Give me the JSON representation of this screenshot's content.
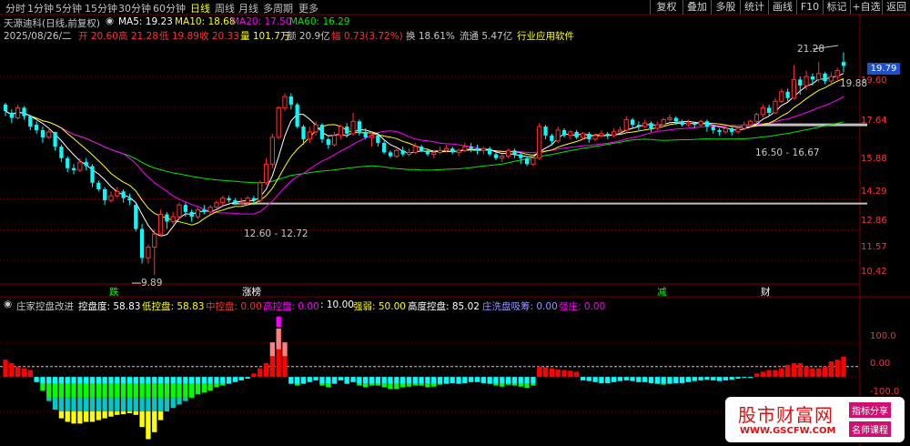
{
  "toolbar": {
    "timeframes": [
      "分时",
      "1分钟",
      "5分钟",
      "15分钟",
      "30分钟",
      "60分钟",
      "日线",
      "周线",
      "月线",
      "多周期",
      "更多"
    ],
    "active_index": 6,
    "buttons": [
      "复权",
      "叠加",
      "多股",
      "统计",
      "画线",
      "F10",
      "标记",
      "+自选",
      "返回"
    ]
  },
  "header": {
    "title": "天源迪科(日线,前复权)",
    "ma": [
      {
        "label": "MA5: 19.23",
        "color": "#ffffff"
      },
      {
        "label": "MA10: 18.68",
        "color": "#ffff00"
      },
      {
        "label": "MA20: 17.50",
        "color": "#ff00ff"
      },
      {
        "label": "MA60: 16.29",
        "color": "#00e600"
      }
    ],
    "quote": [
      {
        "text": "2025/08/26/二",
        "color": "#c8c8c8"
      },
      {
        "text": "开 20.60",
        "color": "#ff3232"
      },
      {
        "text": "高 21.28",
        "color": "#ff3232"
      },
      {
        "text": "低 19.89",
        "color": "#ff3232"
      },
      {
        "text": "收 20.33",
        "color": "#ff3232"
      },
      {
        "text": "量 101.7万",
        "color": "#ffff00"
      },
      {
        "text": "额 20.9亿",
        "color": "#c8c8c8"
      },
      {
        "text": "幅 0.73(3.72%)",
        "color": "#ff3232"
      },
      {
        "text": "换 18.61%",
        "color": "#c8c8c8"
      },
      {
        "text": "流通 5.47亿",
        "color": "#c8c8c8"
      },
      {
        "text": "行业应用软件",
        "color": "#ffff00"
      }
    ]
  },
  "indicator_header": {
    "title": "庄家控盘改进",
    "items": [
      {
        "text": "控盘度: 58.83",
        "color": "#ffffff"
      },
      {
        "text": "低控盘: 58.83",
        "color": "#ffff00"
      },
      {
        "text": "中控盘: 0.00",
        "color": "#ff3232"
      },
      {
        "text": "高控盘: 0.00",
        "color": "#ff00ff"
      },
      {
        "text": ": 10.00",
        "color": "#ffffff"
      },
      {
        "text": "强弱: 50.00",
        "color": "#ffff00"
      },
      {
        "text": "高度控盘: 85.02",
        "color": "#ffffff"
      },
      {
        "text": "庄洗盘吸筹: 0.00",
        "color": "#9696ff"
      },
      {
        "text": "强庄: 0.00",
        "color": "#ff00ff"
      }
    ]
  },
  "price_axis": {
    "ticks": [
      "19.60",
      "17.64",
      "15.88",
      "14.29",
      "12.86",
      "11.57",
      "10.42"
    ],
    "current": "19.79"
  },
  "ind_axis": {
    "ticks": [
      "100.0",
      "0.00",
      "-100.0"
    ]
  },
  "markers": [
    {
      "text": "跌",
      "color": "#00ff00"
    },
    {
      "text": "涨榜",
      "color": "#ffffff"
    },
    {
      "text": "减",
      "color": "#00ff00"
    },
    {
      "text": "财",
      "color": "#ffffff"
    }
  ],
  "annotations": {
    "high_label": "21.28",
    "low_label": "9.89",
    "last_label": "19.88",
    "range_low": "12.60 - 12.72",
    "range_mid": "16.50 - 16.67"
  },
  "watermark": {
    "text": "股市财富网",
    "url": "WWW.GSCFW.COM",
    "tag1": "指标分享",
    "tag2": "名师课程"
  },
  "colors": {
    "up": "#ff3232",
    "down": "#00ffff",
    "ma5": "#ffffff",
    "ma10": "#ffff00",
    "ma20": "#ff00ff",
    "ma60": "#00e600"
  },
  "chart_data": [
    {
      "type": "candlestick",
      "ylim": [
        9.6,
        22.5
      ],
      "scale": "log",
      "candles": [
        [
          17.8,
          17.4,
          17.9,
          17.1
        ],
        [
          17.3,
          17.0,
          17.5,
          16.7
        ],
        [
          17.0,
          17.6,
          17.8,
          16.9
        ],
        [
          17.6,
          17.1,
          17.7,
          16.9
        ],
        [
          17.1,
          16.5,
          17.2,
          16.3
        ],
        [
          16.6,
          16.3,
          16.8,
          16.1
        ],
        [
          16.3,
          15.9,
          16.5,
          15.6
        ],
        [
          15.9,
          16.2,
          16.4,
          15.8
        ],
        [
          16.2,
          15.4,
          16.2,
          15.2
        ],
        [
          15.4,
          14.8,
          15.5,
          14.6
        ],
        [
          14.8,
          14.3,
          14.9,
          14.1
        ],
        [
          14.3,
          14.2,
          14.5,
          14.0
        ],
        [
          14.2,
          14.6,
          14.8,
          14.1
        ],
        [
          14.6,
          14.4,
          14.8,
          14.2
        ],
        [
          14.4,
          13.6,
          14.5,
          13.4
        ],
        [
          13.6,
          13.3,
          13.7,
          13.2
        ],
        [
          13.3,
          12.8,
          13.4,
          12.6
        ],
        [
          12.8,
          13.0,
          13.2,
          12.7
        ],
        [
          13.0,
          13.2,
          13.4,
          12.9
        ],
        [
          13.2,
          12.9,
          13.3,
          12.7
        ],
        [
          12.9,
          12.8,
          13.1,
          12.6
        ],
        [
          12.6,
          11.6,
          12.7,
          11.5
        ],
        [
          11.6,
          10.5,
          11.8,
          10.3
        ],
        [
          10.5,
          10.9,
          11.0,
          10.3
        ],
        [
          10.9,
          11.4,
          11.6,
          9.9
        ],
        [
          11.4,
          12.2,
          12.4,
          11.3
        ],
        [
          12.2,
          11.9,
          12.3,
          11.6
        ],
        [
          11.9,
          12.1,
          12.3,
          11.8
        ],
        [
          12.1,
          12.6,
          12.7,
          12.0
        ],
        [
          12.6,
          12.3,
          12.7,
          12.1
        ],
        [
          12.3,
          12.1,
          12.4,
          11.9
        ],
        [
          12.1,
          12.4,
          12.5,
          12.0
        ],
        [
          12.4,
          12.3,
          12.6,
          12.2
        ],
        [
          12.3,
          12.5,
          12.6,
          12.2
        ],
        [
          12.5,
          12.7,
          12.8,
          12.4
        ],
        [
          12.7,
          12.9,
          13.0,
          12.6
        ],
        [
          12.9,
          12.8,
          13.0,
          12.7
        ],
        [
          12.8,
          12.7,
          12.9,
          12.6
        ],
        [
          12.7,
          12.7,
          12.9,
          12.6
        ],
        [
          12.7,
          12.9,
          13.0,
          12.6
        ],
        [
          12.9,
          12.8,
          13.0,
          12.6
        ],
        [
          12.8,
          13.6,
          13.7,
          12.7
        ],
        [
          13.6,
          14.5,
          14.8,
          13.5
        ],
        [
          14.5,
          15.9,
          16.1,
          14.3
        ],
        [
          15.9,
          17.6,
          17.7,
          15.8
        ],
        [
          17.6,
          18.3,
          18.5,
          17.4
        ],
        [
          18.3,
          17.8,
          18.5,
          17.5
        ],
        [
          17.8,
          16.5,
          17.9,
          16.4
        ],
        [
          16.5,
          15.8,
          16.6,
          15.5
        ],
        [
          15.8,
          16.2,
          16.5,
          15.6
        ],
        [
          16.2,
          16.6,
          16.8,
          16.0
        ],
        [
          16.6,
          15.8,
          16.7,
          15.6
        ],
        [
          15.8,
          15.5,
          15.9,
          15.3
        ],
        [
          15.5,
          16.0,
          16.2,
          15.4
        ],
        [
          16.0,
          16.5,
          16.6,
          15.8
        ],
        [
          16.5,
          16.1,
          16.7,
          15.9
        ],
        [
          16.1,
          16.8,
          17.3,
          16.0
        ],
        [
          16.8,
          16.2,
          16.9,
          16.0
        ],
        [
          16.2,
          15.9,
          16.4,
          15.8
        ],
        [
          15.9,
          16.0,
          16.2,
          15.4
        ],
        [
          16.0,
          15.6,
          16.1,
          15.4
        ],
        [
          15.6,
          15.1,
          15.7,
          15.0
        ],
        [
          15.1,
          14.9,
          15.2,
          14.8
        ],
        [
          14.9,
          15.2,
          15.3,
          14.8
        ],
        [
          15.2,
          15.0,
          15.4,
          14.9
        ],
        [
          15.0,
          15.1,
          15.3,
          14.9
        ],
        [
          15.1,
          15.4,
          15.6,
          15.0
        ],
        [
          15.4,
          15.2,
          15.5,
          15.1
        ],
        [
          15.2,
          15.0,
          15.3,
          14.9
        ],
        [
          15.0,
          15.1,
          15.2,
          14.8
        ],
        [
          15.1,
          15.2,
          15.4,
          15.0
        ],
        [
          15.2,
          15.3,
          15.5,
          15.1
        ],
        [
          15.3,
          15.1,
          15.4,
          15.0
        ],
        [
          15.1,
          15.2,
          15.3,
          14.9
        ],
        [
          15.2,
          15.4,
          15.6,
          15.1
        ],
        [
          15.4,
          15.3,
          15.6,
          15.1
        ],
        [
          15.3,
          15.2,
          15.5,
          15.0
        ],
        [
          15.2,
          15.3,
          15.4,
          15.0
        ],
        [
          15.3,
          15.0,
          15.4,
          14.9
        ],
        [
          15.0,
          14.8,
          15.1,
          14.7
        ],
        [
          14.8,
          14.9,
          15.0,
          14.6
        ],
        [
          14.9,
          15.2,
          15.3,
          14.8
        ],
        [
          15.2,
          15.0,
          15.3,
          14.8
        ],
        [
          15.0,
          14.8,
          15.1,
          14.5
        ],
        [
          14.8,
          14.5,
          14.9,
          14.4
        ],
        [
          14.5,
          14.8,
          14.9,
          14.4
        ],
        [
          14.8,
          16.5,
          16.7,
          14.7
        ],
        [
          16.5,
          16.0,
          16.6,
          15.8
        ],
        [
          16.0,
          15.7,
          16.1,
          15.5
        ],
        [
          15.7,
          16.3,
          16.5,
          15.6
        ],
        [
          16.3,
          16.0,
          16.4,
          15.9
        ],
        [
          16.0,
          16.2,
          16.3,
          15.8
        ],
        [
          16.2,
          15.9,
          16.3,
          15.8
        ],
        [
          15.9,
          16.1,
          16.2,
          15.8
        ],
        [
          16.1,
          15.8,
          16.2,
          15.6
        ],
        [
          15.8,
          16.0,
          16.1,
          15.7
        ],
        [
          16.0,
          16.1,
          16.3,
          15.9
        ],
        [
          16.1,
          16.0,
          16.2,
          15.8
        ],
        [
          16.0,
          16.2,
          16.4,
          15.9
        ],
        [
          16.2,
          16.3,
          16.5,
          16.1
        ],
        [
          16.3,
          16.9,
          17.1,
          16.2
        ],
        [
          16.9,
          16.6,
          17.0,
          16.4
        ],
        [
          16.6,
          16.5,
          16.8,
          16.3
        ],
        [
          16.5,
          16.7,
          16.9,
          16.4
        ],
        [
          16.7,
          16.4,
          16.8,
          16.2
        ],
        [
          16.4,
          16.6,
          16.8,
          16.3
        ],
        [
          16.6,
          16.9,
          17.0,
          16.5
        ],
        [
          16.9,
          17.0,
          17.2,
          16.8
        ],
        [
          17.0,
          16.8,
          17.1,
          16.6
        ],
        [
          16.8,
          16.6,
          16.9,
          16.5
        ],
        [
          16.6,
          16.7,
          16.9,
          16.5
        ],
        [
          16.7,
          16.6,
          16.8,
          16.4
        ],
        [
          16.6,
          16.8,
          16.9,
          16.5
        ],
        [
          16.8,
          16.5,
          16.9,
          16.2
        ],
        [
          16.5,
          16.3,
          16.6,
          16.1
        ],
        [
          16.3,
          16.2,
          16.4,
          16.0
        ],
        [
          16.2,
          16.4,
          16.5,
          16.1
        ],
        [
          16.4,
          16.2,
          16.5,
          16.0
        ],
        [
          16.2,
          16.4,
          16.5,
          16.1
        ],
        [
          16.4,
          16.6,
          16.8,
          16.3
        ],
        [
          16.6,
          16.8,
          16.9,
          16.5
        ],
        [
          16.8,
          17.2,
          17.3,
          16.7
        ],
        [
          17.2,
          17.6,
          17.8,
          17.0
        ],
        [
          17.6,
          17.3,
          17.8,
          17.1
        ],
        [
          17.3,
          18.0,
          18.2,
          17.2
        ],
        [
          18.0,
          18.6,
          18.8,
          17.9
        ],
        [
          18.6,
          18.2,
          18.8,
          18.0
        ],
        [
          18.2,
          19.4,
          20.4,
          18.1
        ],
        [
          19.4,
          19.0,
          19.6,
          18.4
        ],
        [
          19.0,
          19.6,
          20.0,
          18.7
        ],
        [
          19.6,
          19.4,
          19.8,
          19.0
        ],
        [
          19.4,
          19.8,
          20.6,
          19.2
        ],
        [
          19.8,
          19.3,
          19.9,
          19.1
        ],
        [
          19.3,
          19.6,
          19.9,
          19.0
        ],
        [
          19.6,
          20.0,
          20.2,
          19.3
        ],
        [
          20.6,
          20.33,
          21.28,
          19.89
        ]
      ]
    },
    {
      "type": "bar",
      "ylim": [
        -200,
        190
      ],
      "series": [
        {
          "name": "低控盘",
          "values": [
            50,
            40,
            30,
            25,
            20,
            -15,
            -40,
            -70,
            -95,
            -120,
            -130,
            -135,
            -135,
            -130,
            -130,
            -125,
            -120,
            -115,
            -110,
            -108,
            -105,
            -110,
            -145,
            -180,
            -160,
            -125,
            -100,
            -90,
            -80,
            -70,
            -60,
            -50,
            -45,
            -40,
            -30,
            -25,
            -20,
            -15,
            -10,
            -5,
            10,
            25,
            40,
            60,
            80,
            60,
            -20,
            -25,
            -20,
            -15,
            -10,
            -25,
            -30,
            -20,
            -10,
            -20,
            -15,
            -25,
            -30,
            -25,
            -25,
            -30,
            -35,
            -35,
            -30,
            -28,
            -25,
            -25,
            -30,
            -28,
            -22,
            -20,
            -18,
            -20,
            -18,
            -15,
            -15,
            -18,
            -20,
            -25,
            -28,
            -22,
            -25,
            -28,
            -32,
            -25,
            30,
            28,
            25,
            22,
            20,
            18,
            15,
            -10,
            -12,
            -15,
            -18,
            -18,
            -15,
            -12,
            -10,
            -12,
            -15,
            -15,
            -18,
            -20,
            -22,
            -20,
            -18,
            -18,
            -15,
            -12,
            -10,
            -8,
            -10,
            -12,
            -10,
            -8,
            -5,
            -3,
            -2,
            10,
            15,
            20,
            20,
            25,
            35,
            40,
            40,
            30,
            25,
            25,
            30,
            45,
            50,
            58.83
          ]
        },
        {
          "name": "中控盘",
          "values": [
            0,
            0,
            0,
            0,
            0,
            0,
            0,
            0,
            0,
            0,
            0,
            0,
            0,
            0,
            0,
            0,
            0,
            0,
            0,
            0,
            0,
            0,
            0,
            0,
            0,
            0,
            0,
            0,
            0,
            0,
            0,
            0,
            0,
            0,
            0,
            0,
            0,
            0,
            0,
            0,
            0,
            0,
            0,
            40,
            60,
            40,
            0,
            0,
            0,
            0,
            0,
            0,
            0,
            0,
            0,
            0,
            0,
            0,
            0,
            0,
            0,
            0,
            0,
            0,
            0,
            0,
            0,
            0,
            0,
            0,
            0,
            0,
            0,
            0,
            0,
            0,
            0,
            0,
            0,
            0,
            0,
            0,
            0,
            0,
            0,
            0,
            0,
            0,
            0,
            0,
            0,
            0,
            0,
            0,
            0,
            0,
            0,
            0,
            0,
            0,
            0,
            0,
            0,
            0,
            0,
            0,
            0,
            0,
            0,
            0,
            0,
            0,
            0,
            0,
            0,
            0,
            0,
            0,
            0,
            0,
            0,
            0,
            0,
            0,
            0,
            0,
            0,
            0,
            0,
            0,
            0,
            0,
            0,
            0,
            0
          ]
        }
      ]
    }
  ]
}
